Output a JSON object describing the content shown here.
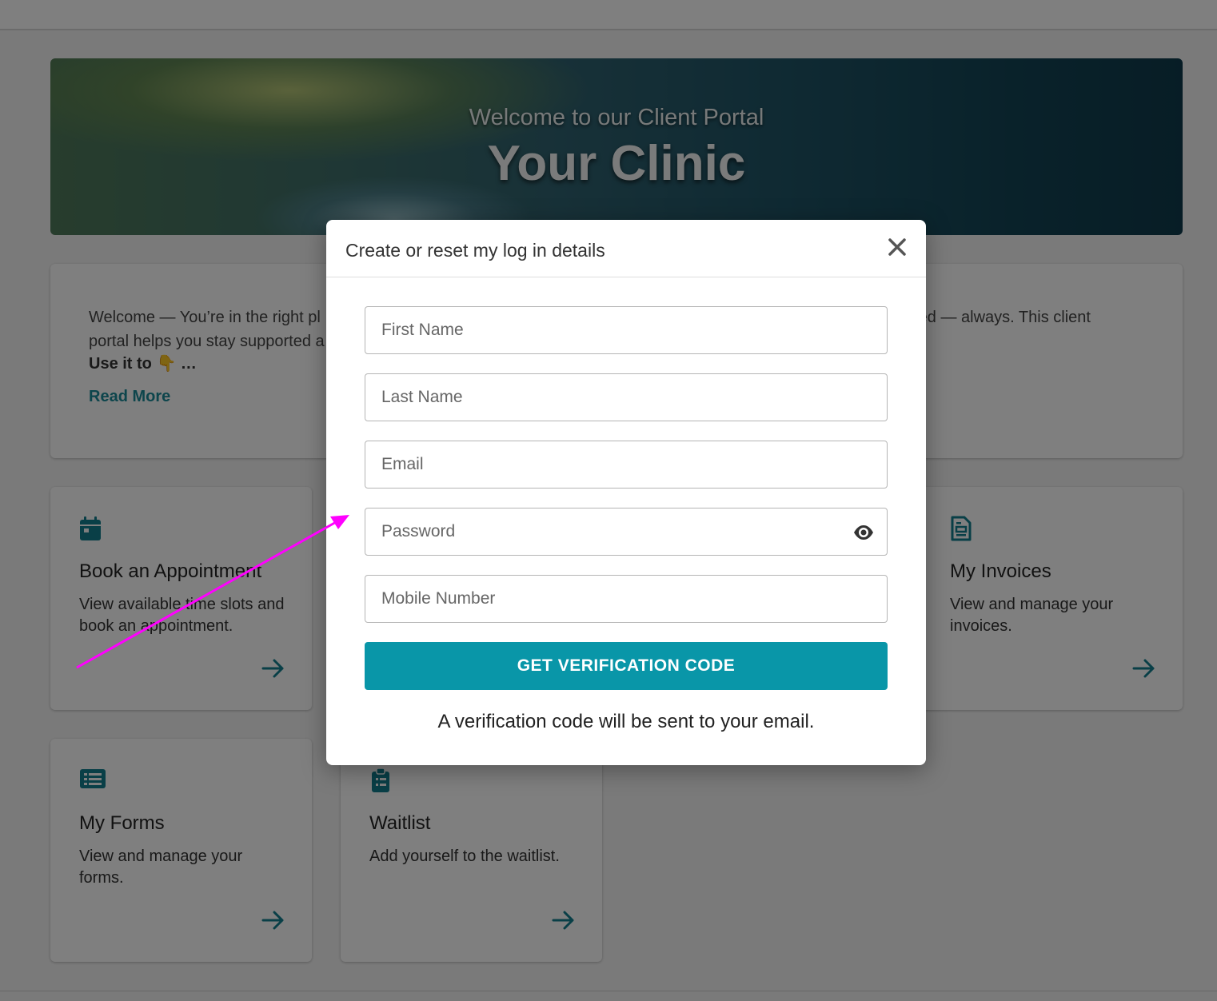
{
  "hero": {
    "subtitle": "Welcome to our Client Portal",
    "title": "Your Clinic"
  },
  "welcome": {
    "text_left": "Welcome — You’re in the right pl",
    "text_left_2": "portal helps you stay supported a",
    "text_right": "ected — always. This client",
    "bold_line": "Use it to 👇 …",
    "read_more": "Read More"
  },
  "tiles": [
    {
      "title": "Book an Appointment",
      "desc": "View available time slots and book an appointment.",
      "icon": "calendar-icon"
    },
    {
      "title": "My Invoices",
      "desc": "View and manage your invoices.",
      "icon": "invoice-icon"
    },
    {
      "title": "My Forms",
      "desc": "View and manage your forms.",
      "icon": "list-icon"
    },
    {
      "title": "Waitlist",
      "desc": "Add yourself to the waitlist.",
      "icon": "clipboard-icon"
    }
  ],
  "modal": {
    "title": "Create or reset my log in details",
    "fields": {
      "first_name": "First Name",
      "last_name": "Last Name",
      "email": "Email",
      "password": "Password",
      "mobile": "Mobile Number"
    },
    "button": "GET VERIFICATION CODE",
    "note": "A verification code will be sent to your email."
  },
  "colors": {
    "accent": "#0996a8",
    "teal_icon": "#137f8e",
    "annotation_arrow": "#ff00ff"
  }
}
